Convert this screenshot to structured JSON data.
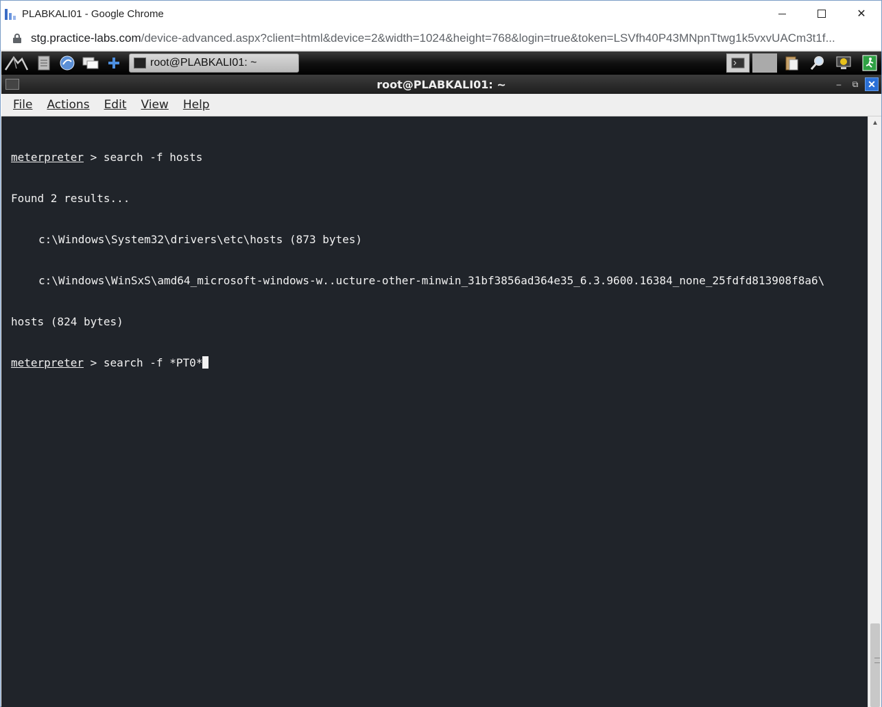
{
  "browser": {
    "window_title": "PLABKALI01 - Google Chrome",
    "url_host": "stg.practice-labs.com",
    "url_path": "/device-advanced.aspx?client=html&device=2&width=1024&height=768&login=true&token=LSVfh40P43MNpnTtwg1k5vxvUACm3t1f..."
  },
  "panel": {
    "task_label": "root@PLABKALI01: ~"
  },
  "terminal": {
    "title": "root@PLABKALI01: ~",
    "menu": [
      "File",
      "Actions",
      "Edit",
      "View",
      "Help"
    ],
    "lines": {
      "l1_prompt": "meterpreter",
      "l1_cmd": " > search -f hosts",
      "l2": "Found 2 results...",
      "l3": "c:\\Windows\\System32\\drivers\\etc\\hosts (873 bytes)",
      "l4": "c:\\Windows\\WinSxS\\amd64_microsoft-windows-w..ucture-other-minwin_31bf3856ad364e35_6.3.9600.16384_none_25fdfd813908f8a6\\",
      "l5": "hosts (824 bytes)",
      "l6_prompt": "meterpreter",
      "l6_cmd": " > search -f *PT0*"
    }
  },
  "colors": {
    "terminal_bg": "#20242a",
    "terminal_fg": "#f2f2f2",
    "close_button": "#2a6fd6"
  }
}
